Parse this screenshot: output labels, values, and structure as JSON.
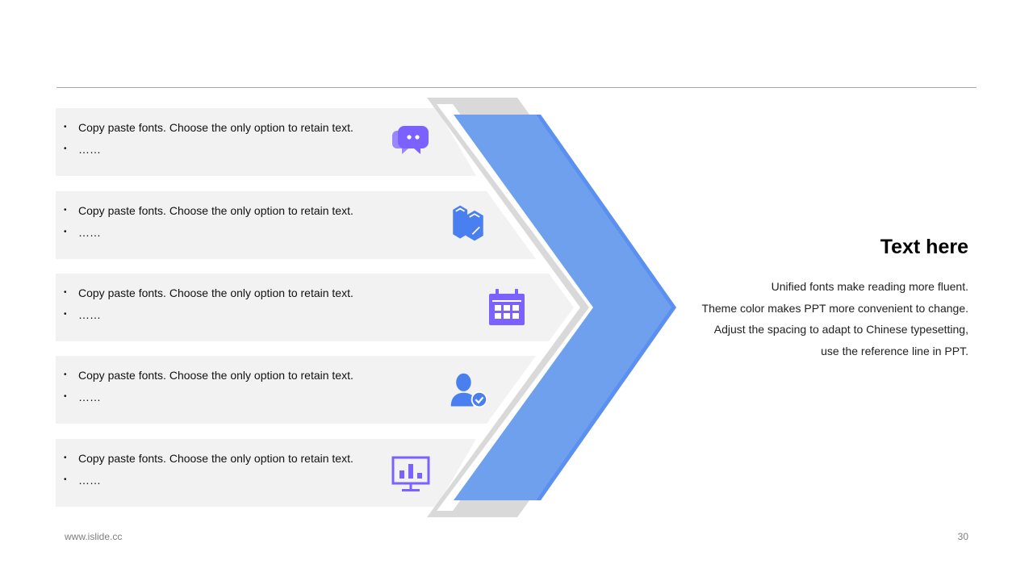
{
  "colors": {
    "band_bg": "#f2f2f2",
    "chevron_gray": "#d9d9d9",
    "chevron_blue": "#6fa0ee",
    "chevron_blue_edge": "#5b8ff0",
    "icon_purple": "#7b61ff",
    "icon_blue": "#4a7ff0"
  },
  "rows": [
    {
      "line1": "Copy paste fonts. Choose the only option to retain text.",
      "line2": "……",
      "icon": "chat-bubbles-icon"
    },
    {
      "line1": "Copy paste fonts. Choose the only option to retain text.",
      "line2": "……",
      "icon": "books-icon"
    },
    {
      "line1": "Copy paste fonts. Choose the only option to retain text.",
      "line2": "……",
      "icon": "calendar-icon"
    },
    {
      "line1": "Copy paste fonts. Choose the only option to retain text.",
      "line2": "……",
      "icon": "user-check-icon"
    },
    {
      "line1": "Copy paste fonts. Choose the only option to retain text.",
      "line2": "……",
      "icon": "presentation-chart-icon"
    }
  ],
  "bullet_symbol": "•",
  "right": {
    "title": "Text here",
    "lines": [
      "Unified fonts make reading more fluent.",
      "Theme color makes PPT more convenient to change.",
      "Adjust the spacing to adapt to Chinese typesetting,",
      "use the reference line in PPT."
    ]
  },
  "footer": {
    "website": "www.islide.cc",
    "page_number": "30"
  }
}
